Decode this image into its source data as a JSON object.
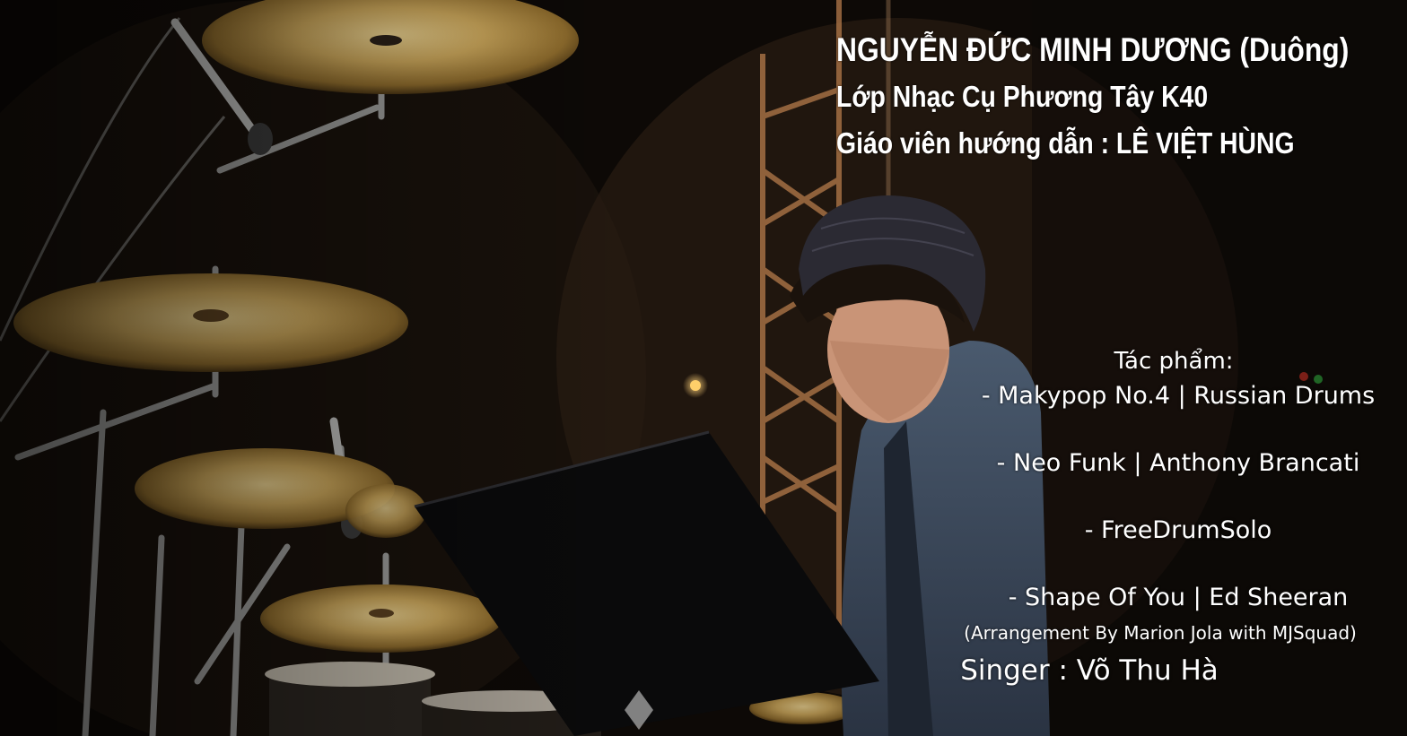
{
  "performer": {
    "name": "NGUYỄN ĐỨC MINH DƯƠNG (Duông)",
    "class": "Lớp Nhạc Cụ Phương Tây K40",
    "teacher": "Giáo viên hướng dẫn : LÊ VIỆT HÙNG"
  },
  "works": {
    "label": "Tác phẩm:",
    "items": [
      "- Makypop No.4 | Russian Drums",
      "- Neo Funk | Anthony Brancati",
      "- FreeDrumSolo",
      "- Shape Of You | Ed Sheeran"
    ],
    "arrangement_note": "(Arrangement By Marion Jola with MJSquad)",
    "singer": "Singer : Võ Thu Hà"
  },
  "colors": {
    "text": "#ffffff",
    "cymbal": "#c9a55a",
    "background": "#120c08"
  }
}
